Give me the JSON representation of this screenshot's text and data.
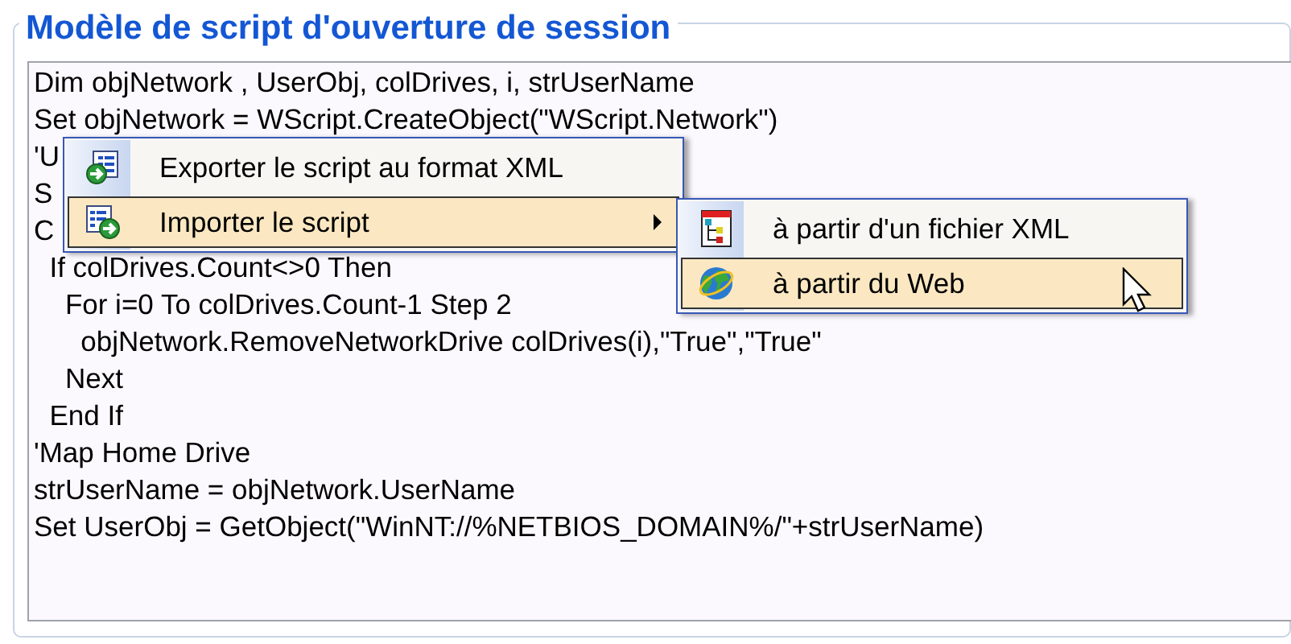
{
  "group": {
    "title": "Modèle de script d'ouverture de session"
  },
  "script": {
    "lines": [
      "Dim objNetwork , UserObj, colDrives, i, strUserName",
      "Set objNetwork = WScript.CreateObject(\"WScript.Network\")",
      "'U",
      "S",
      "C",
      "  If colDrives.Count<>0 Then",
      "    For i=0 To colDrives.Count-1 Step 2",
      "      objNetwork.RemoveNetworkDrive colDrives(i),\"True\",\"True\"",
      "    Next",
      "  End If",
      "'Map Home Drive",
      "strUserName = objNetwork.UserName",
      "Set UserObj = GetObject(\"WinNT://%NETBIOS_DOMAIN%/\"+strUserName)"
    ]
  },
  "context_menu": {
    "items": [
      {
        "label": "Exporter le script au format XML",
        "kind": "export",
        "selected": false,
        "has_submenu": false
      },
      {
        "label": "Importer le script",
        "kind": "import",
        "selected": true,
        "has_submenu": true
      }
    ]
  },
  "submenu": {
    "items": [
      {
        "label": "à partir d'un fichier XML",
        "kind": "xml",
        "selected": false
      },
      {
        "label": "à partir du Web",
        "kind": "web",
        "selected": true
      }
    ]
  }
}
